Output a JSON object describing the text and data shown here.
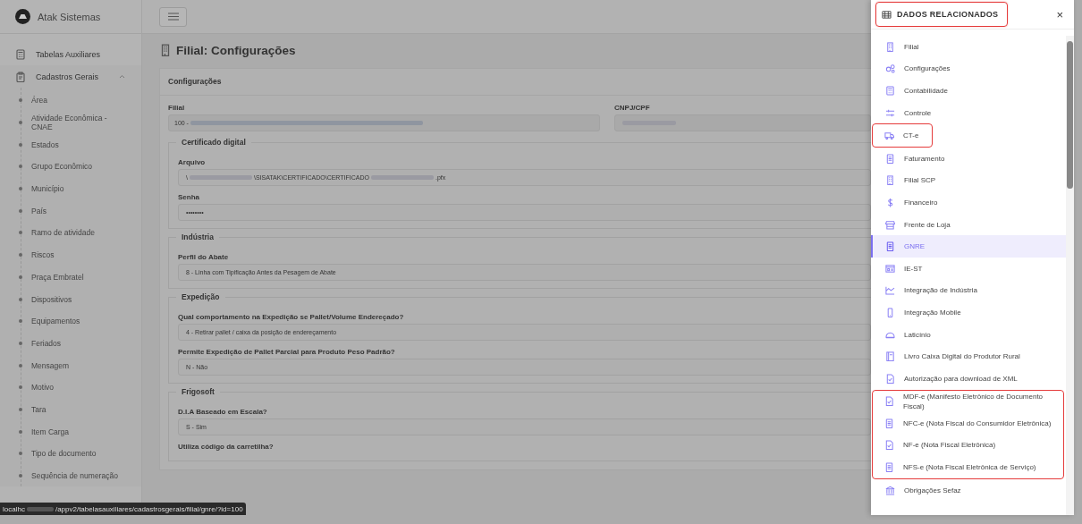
{
  "app": {
    "name": "Atak Sistemas"
  },
  "sidebar": {
    "items": [
      {
        "label": "Tabelas Auxiliares"
      },
      {
        "label": "Cadastros Gerais",
        "expanded": true,
        "children": [
          {
            "label": "Área"
          },
          {
            "label": "Atividade Econômica - CNAE"
          },
          {
            "label": "Estados"
          },
          {
            "label": "Grupo Econômico"
          },
          {
            "label": "Município"
          },
          {
            "label": "País"
          },
          {
            "label": "Ramo de atividade"
          },
          {
            "label": "Riscos"
          },
          {
            "label": "Praça Embratel"
          },
          {
            "label": "Dispositivos"
          },
          {
            "label": "Equipamentos"
          },
          {
            "label": "Feriados"
          },
          {
            "label": "Mensagem"
          },
          {
            "label": "Motivo"
          },
          {
            "label": "Tara"
          },
          {
            "label": "Item Carga"
          },
          {
            "label": "Tipo de documento"
          },
          {
            "label": "Sequência de numeração"
          }
        ]
      }
    ]
  },
  "page": {
    "title": "Filial: Configurações",
    "card": {
      "title": "Configurações",
      "fields": [
        {
          "label": "Filial",
          "value": [
            {
              "kind": "text",
              "text": "100 -"
            },
            {
              "kind": "redacted"
            }
          ]
        },
        {
          "label": "CNPJ/CPF",
          "value": [
            {
              "kind": "redacted"
            }
          ]
        }
      ],
      "sections": [
        {
          "title": "Certificado digital",
          "fields": [
            {
              "label": "Arquivo",
              "value": [
                {
                  "kind": "text",
                  "text": "\\"
                },
                {
                  "kind": "redacted"
                },
                {
                  "kind": "text",
                  "text": "\\SISATAK\\CERTIFICADO\\CERTIFICADO"
                },
                {
                  "kind": "redacted"
                },
                {
                  "kind": "text",
                  "text": ".pfx"
                }
              ]
            },
            {
              "label": "Senha",
              "value": [
                {
                  "kind": "text",
                  "text": "••••••••"
                }
              ]
            }
          ]
        },
        {
          "title": "Indústria",
          "fields": [
            {
              "label": "Perfil do Abate",
              "value": [
                {
                  "kind": "text",
                  "text": "8 - Linha com Tipificação Antes da Pesagem de Abate"
                }
              ]
            }
          ]
        },
        {
          "title": "Expedição",
          "fields": [
            {
              "label": "Qual comportamento na Expedição se Pallet/Volume Endereçado?",
              "value": [
                {
                  "kind": "text",
                  "text": "4 - Retirar pallet / caixa da posição de endereçamento"
                }
              ]
            },
            {
              "label": "Permite Expedição de Pallet Parcial para Produto Peso Padrão?",
              "value": [
                {
                  "kind": "text",
                  "text": "N - Não"
                }
              ]
            }
          ]
        },
        {
          "title": "Frigosoft",
          "fields": [
            {
              "label": "D.I.A Baseado em Escala?",
              "value": [
                {
                  "kind": "text",
                  "text": "S - Sim"
                }
              ]
            },
            {
              "label": "Utiliza código da carretilha?"
            }
          ]
        }
      ]
    }
  },
  "status_bar": {
    "url": [
      {
        "kind": "text",
        "text": "localhc"
      },
      {
        "kind": "redacted"
      },
      {
        "kind": "text",
        "text": "/appv2/tabelasauxiliares/cadastrosgerais/filial/gnre/?id=100"
      }
    ]
  },
  "related": {
    "title": "DADOS RELACIONADOS",
    "highlighted": true,
    "close": "×",
    "items": [
      {
        "label": "Filial",
        "selected": false,
        "highlighted": false
      },
      {
        "label": "Configurações",
        "selected": false,
        "highlighted": false
      },
      {
        "label": "Contabilidade",
        "selected": false,
        "highlighted": false
      },
      {
        "label": "Controle",
        "selected": false,
        "highlighted": false
      },
      {
        "label": "CT-e",
        "selected": false,
        "highlighted": true
      },
      {
        "label": "Faturamento",
        "selected": false,
        "highlighted": false
      },
      {
        "label": "Filial SCP",
        "selected": false,
        "highlighted": false
      },
      {
        "label": "Financeiro",
        "selected": false,
        "highlighted": false
      },
      {
        "label": "Frente de Loja",
        "selected": false,
        "highlighted": false
      },
      {
        "label": "GNRE",
        "selected": true,
        "highlighted": false
      },
      {
        "label": "IE-ST",
        "selected": false,
        "highlighted": false
      },
      {
        "label": "Integração de Indústria",
        "selected": false,
        "highlighted": false
      },
      {
        "label": "Integração Mobile",
        "selected": false,
        "highlighted": false
      },
      {
        "label": "Laticínio",
        "selected": false,
        "highlighted": false
      },
      {
        "label": "Livro Caixa Digital do Produtor Rural",
        "selected": false,
        "highlighted": false
      },
      {
        "label": "Autorização para download de XML",
        "selected": false,
        "highlighted": false
      },
      {
        "label": "MDF-e (Manifesto Eletrônico de Documento Fiscal)",
        "selected": false,
        "highlighted": true
      },
      {
        "label": "NFC-e (Nota Fiscal do Consumidor Eletrônica)",
        "selected": false,
        "highlighted": true
      },
      {
        "label": "NF-e (Nota Fiscal Eletrônica)",
        "selected": false,
        "highlighted": true
      },
      {
        "label": "NFS-e (Nota Fiscal Eletrônica de Serviço)",
        "selected": false,
        "highlighted": true
      },
      {
        "label": "Obrigações Sefaz",
        "selected": false,
        "highlighted": false
      }
    ]
  }
}
